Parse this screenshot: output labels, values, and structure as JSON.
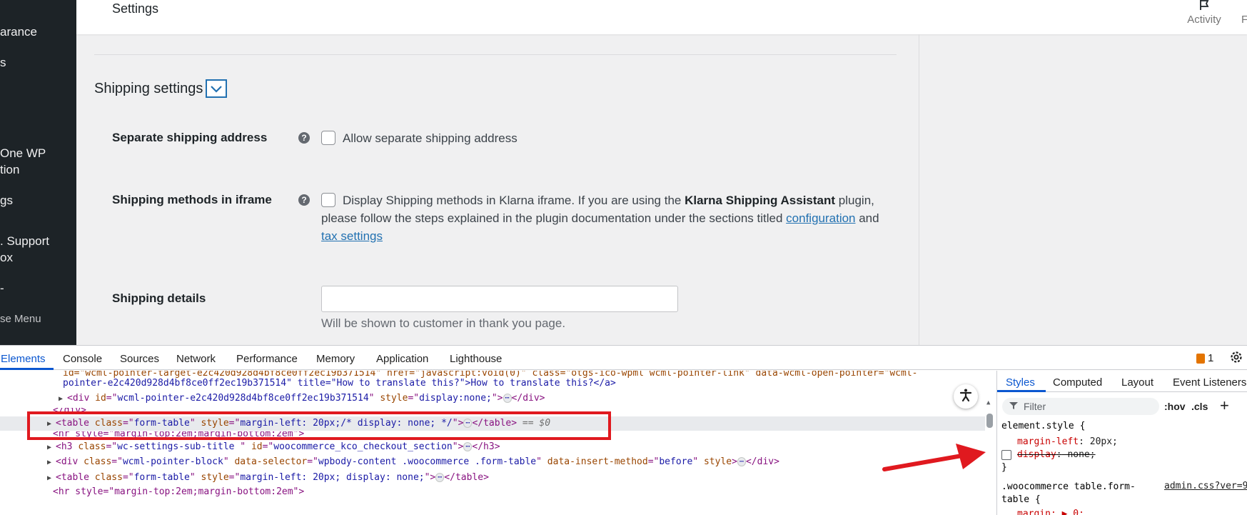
{
  "sidebar": {
    "items": [
      "arance",
      "s",
      "One WP",
      "tion",
      "gs",
      ". Support",
      "ox",
      "-"
    ],
    "collapse": "se Menu"
  },
  "header": {
    "title": "Settings",
    "activity_label": "Activity",
    "finish_label": "Finish"
  },
  "shipping": {
    "section_title": "Shipping settings",
    "separate_address": {
      "label": "Separate shipping address",
      "checkbox_label": "Allow separate shipping address"
    },
    "methods_iframe": {
      "label": "Shipping methods in iframe",
      "text_before": "Display Shipping methods in Klarna iframe. If you are using the ",
      "text_bold": "Klarna Shipping Assistant",
      "text_after": " plugin,",
      "text_line2": "please follow the steps explained in the plugin documentation under the sections titled ",
      "link_configuration": "configuration",
      "text_and": " and",
      "link_tax": "tax settings"
    },
    "details": {
      "label": "Shipping details",
      "value": "",
      "description": "Will be shown to customer in thank you page."
    }
  },
  "devtools": {
    "tabs": [
      "Elements",
      "Console",
      "Sources",
      "Network",
      "Performance",
      "Memory",
      "Application",
      "Lighthouse"
    ],
    "issues_count": "1",
    "dom": {
      "l0a": "id=\"wcml-pointer-target-e2c420d928d4bf8ce0ff2ec19b371514\" href=\"javascript:void(0)\" class=\"otgs-ico-wpml wcml-pointer-link\" data-wcml-open-pointer=\"wcml-",
      "l1_text": "pointer-e2c420d928d4bf8ce0ff2ec19b371514\" title=\"How to translate this?\">How to translate this?</a>",
      "l2_id": "wcml-pointer-e2c420d928d4bf8ce0ff2ec19b371514",
      "l2_style": "display:none;",
      "l3": "</div>",
      "l4_class": "form-table",
      "l4_style": "margin-left: 20px;/* display: none; */",
      "l4_dollar": "== $0",
      "l5": "<hr style=\"margin-top:2em;margin-bottom:2em\">",
      "l6_class": "wc-settings-sub-title ",
      "l6_id": "woocommerce_kco_checkout_section",
      "l7_class": "wcml-pointer-block",
      "l7_selector": "wpbody-content .woocommerce .form-table",
      "l7_insert": "before",
      "l8_class": "form-table",
      "l8_style": "margin-left: 20px; display: none;",
      "l9": "<hr style=\"margin-top:2em;margin-bottom:2em\">"
    },
    "styles": {
      "tabs": [
        "Styles",
        "Computed",
        "Layout",
        "Event Listeners"
      ],
      "filter_placeholder": "Filter",
      "hov": ":hov",
      "cls": ".cls",
      "element_style": "element.style {",
      "prop1_name": "margin-left",
      "prop1_value": " 20px;",
      "prop2_name": "display",
      "prop2_value": " none;",
      "close_brace": "}",
      "rule2_selector_line1": ".woocommerce table.form-",
      "rule2_selector_line2": "table {",
      "rule2_source": "admin.css?ver=9",
      "rule2_partial": "margin: ▶ 0;"
    }
  },
  "colors": {
    "wp_sidebar": "#1d2327",
    "link": "#2271b1",
    "annotation_red": "#e0191f",
    "devtools_active": "#0b57d0"
  }
}
